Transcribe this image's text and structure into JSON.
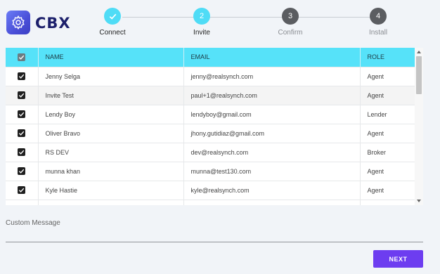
{
  "app": {
    "logo_text": "CBX",
    "accent_color": "#4fdcf6",
    "primary_button_color": "#6d3df0"
  },
  "stepper": {
    "steps": [
      {
        "label": "Connect",
        "number": "",
        "state": "done"
      },
      {
        "label": "Invite",
        "number": "2",
        "state": "active"
      },
      {
        "label": "Confirm",
        "number": "3",
        "state": "pending"
      },
      {
        "label": "Install",
        "number": "4",
        "state": "pending"
      }
    ]
  },
  "table": {
    "headers": {
      "name": "NAME",
      "email": "EMAIL",
      "role": "ROLE"
    },
    "rows": [
      {
        "name": "Jenny Selga",
        "email": "jenny@realsynch.com",
        "role": "Agent",
        "checked": true
      },
      {
        "name": "Invite Test",
        "email": "paul+1@realsynch.com",
        "role": "Agent",
        "checked": true
      },
      {
        "name": "Lendy Boy",
        "email": "lendyboy@gmail.com",
        "role": "Lender",
        "checked": true
      },
      {
        "name": "Oliver Bravo",
        "email": "jhony.gutidiaz@gmail.com",
        "role": "Agent",
        "checked": true
      },
      {
        "name": "RS DEV",
        "email": "dev@realsynch.com",
        "role": "Broker",
        "checked": true
      },
      {
        "name": "munna khan",
        "email": "munna@test130.com",
        "role": "Agent",
        "checked": true
      },
      {
        "name": "Kyle Hastie",
        "email": "kyle@realsynch.com",
        "role": "Agent",
        "checked": true
      }
    ]
  },
  "custom_message": {
    "label": "Custom Message"
  },
  "actions": {
    "next_label": "NEXT"
  }
}
